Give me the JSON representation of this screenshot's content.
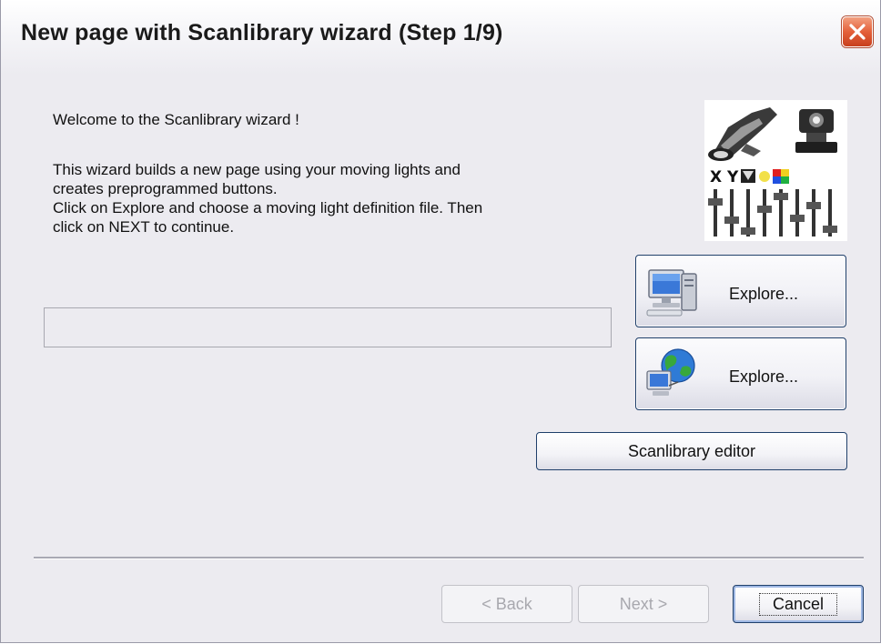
{
  "window": {
    "title": "New page with Scanlibrary wizard (Step 1/9)"
  },
  "content": {
    "welcome": "Welcome to the Scanlibrary wizard !",
    "description_lines": [
      "This wizard builds a new page using your moving lights and",
      "creates preprogrammed buttons.",
      "Click on Explore and choose a moving light definition file. Then",
      "click on NEXT to continue."
    ],
    "file_field_value": "",
    "logo_text": "X Y"
  },
  "buttons": {
    "explore_local": {
      "label": "Explore...",
      "icon": "computer-icon"
    },
    "explore_web": {
      "label": "Explore...",
      "icon": "globe-network-icon"
    },
    "scanlibrary_editor": "Scanlibrary editor",
    "back": "< Back",
    "next": "Next >",
    "cancel": "Cancel"
  },
  "colors": {
    "window_bg": "#ecebf0",
    "close_button": "#e4603a",
    "button_border": "#1f3f6a"
  }
}
